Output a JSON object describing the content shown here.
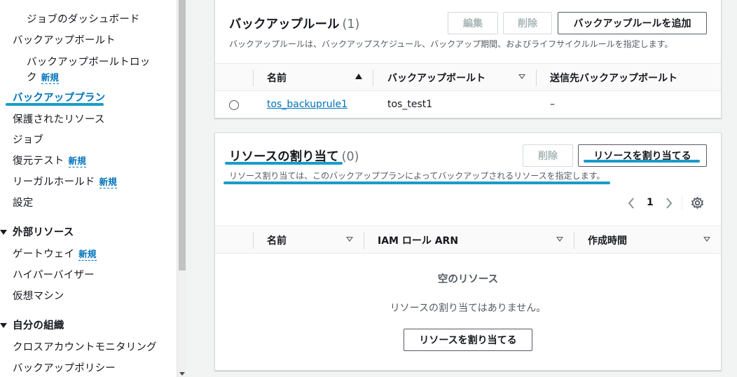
{
  "sidebar": {
    "items": [
      {
        "label": "ジョブのダッシュボード"
      },
      {
        "label": "バックアップボールト"
      },
      {
        "label": "バックアップボールトロッ",
        "label2": "ク",
        "badge": "新規"
      },
      {
        "label": "バックアッププラン"
      },
      {
        "label": "保護されたリソース"
      },
      {
        "label": "ジョブ"
      },
      {
        "label": "復元テスト",
        "badge": "新規"
      },
      {
        "label": "リーガルホールド",
        "badge": "新規"
      },
      {
        "label": "設定"
      },
      {
        "label": "外部リソース"
      },
      {
        "label": "ゲートウェイ",
        "badge": "新規"
      },
      {
        "label": "ハイパーバイザー"
      },
      {
        "label": "仮想マシン"
      },
      {
        "label": "自分の組織"
      },
      {
        "label": "クロスアカウントモニタリング"
      },
      {
        "label": "バックアップポリシー"
      }
    ]
  },
  "rules_panel": {
    "title": "バックアップルール",
    "count": "(1)",
    "description": "バックアップルールは、バックアップスケジュール、バックアップ期間、およびライフサイクルルールを指定します。",
    "edit_label": "編集",
    "delete_label": "削除",
    "add_label": "バックアップルールを追加",
    "columns": [
      "名前",
      "バックアップボールト",
      "送信先バックアップボールト"
    ],
    "rows": [
      {
        "name": "tos_backuprule1",
        "vault": "tos_test1",
        "dest": "–"
      }
    ]
  },
  "assign_panel": {
    "title": "リソースの割り当て",
    "count": "(0)",
    "description": "リソース割り当ては、このバックアッププランによってバックアップされるリソースを指定します。",
    "delete_label": "削除",
    "assign_label": "リソースを割り当てる",
    "page_number": "1",
    "columns": [
      "名前",
      "IAM ロール ARN",
      "作成時間"
    ],
    "empty_title": "空のリソース",
    "empty_text": "リソースの割り当てはありません。",
    "empty_button": "リソースを割り当てる"
  },
  "colors": {
    "accent": "#0073bb",
    "highlight": "#1a9cc9"
  }
}
